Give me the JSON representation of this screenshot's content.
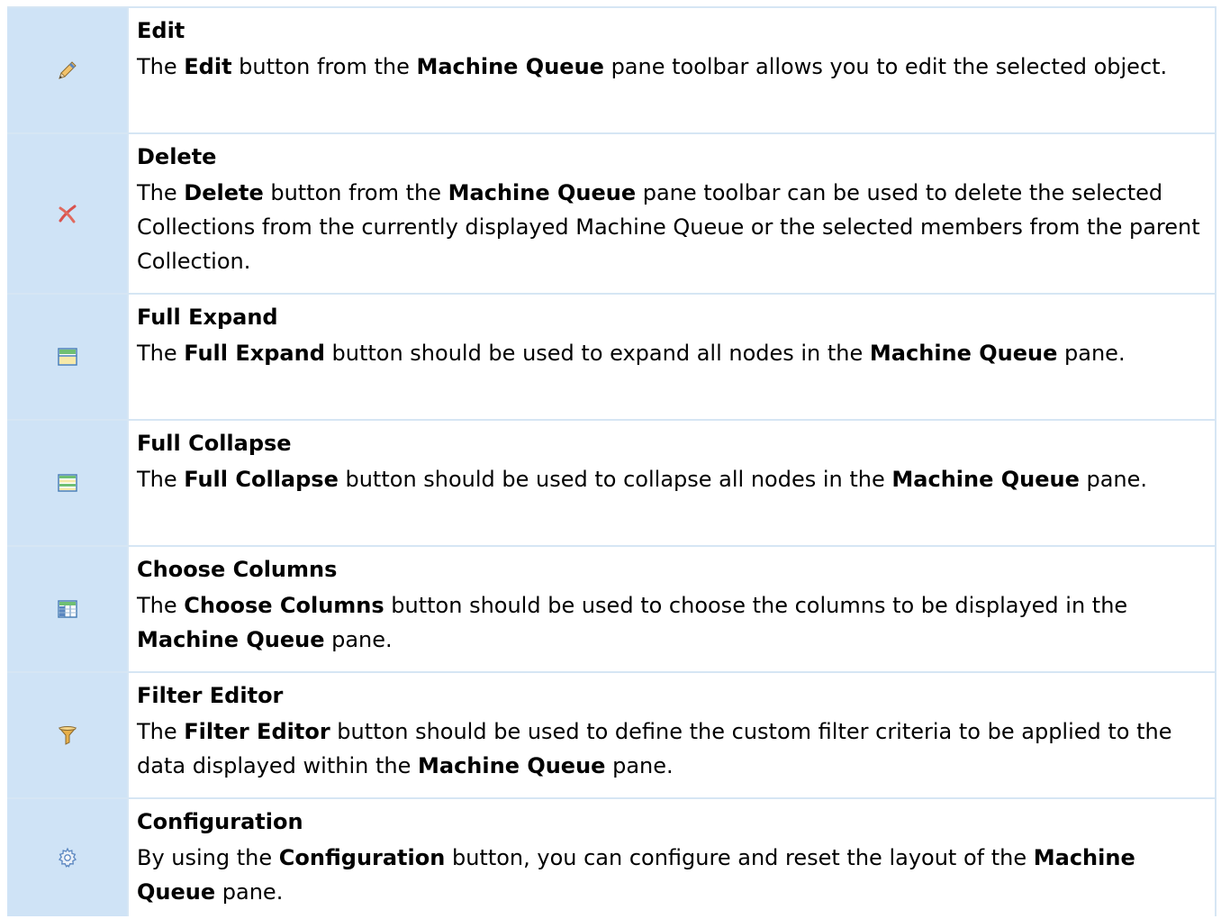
{
  "rows": [
    {
      "icon": "pencil-icon",
      "title": "Edit",
      "desc": [
        {
          "t": "The "
        },
        {
          "t": "Edit",
          "b": true
        },
        {
          "t": " button from the "
        },
        {
          "t": "Machine Queue",
          "b": true
        },
        {
          "t": " pane toolbar allows you to edit the selected object."
        }
      ]
    },
    {
      "icon": "delete-x-icon",
      "title": "Delete",
      "desc": [
        {
          "t": "The "
        },
        {
          "t": "Delete",
          "b": true
        },
        {
          "t": " button from the "
        },
        {
          "t": "Machine Queue",
          "b": true
        },
        {
          "t": " pane toolbar can be used to delete the selected Collections from the currently displayed Machine Queue or the selected members from the parent Collection."
        }
      ]
    },
    {
      "icon": "full-expand-icon",
      "title": "Full Expand",
      "desc": [
        {
          "t": "The "
        },
        {
          "t": "Full Expand",
          "b": true
        },
        {
          "t": " button should be used to expand all nodes in the "
        },
        {
          "t": "Machine Queue",
          "b": true
        },
        {
          "t": " pane."
        }
      ]
    },
    {
      "icon": "full-collapse-icon",
      "title": "Full Collapse",
      "desc": [
        {
          "t": "The "
        },
        {
          "t": "Full Collapse",
          "b": true
        },
        {
          "t": " button should be used to collapse all nodes in the "
        },
        {
          "t": "Machine Queue",
          "b": true
        },
        {
          "t": " pane."
        }
      ]
    },
    {
      "icon": "choose-columns-icon",
      "title": "Choose Columns",
      "desc": [
        {
          "t": "The "
        },
        {
          "t": "Choose Columns",
          "b": true
        },
        {
          "t": " button should be used to choose the columns to be displayed in the "
        },
        {
          "t": "Machine Queue",
          "b": true
        },
        {
          "t": " pane."
        }
      ]
    },
    {
      "icon": "filter-funnel-icon",
      "title": "Filter Editor",
      "desc": [
        {
          "t": "The "
        },
        {
          "t": "Filter Editor",
          "b": true
        },
        {
          "t": " button should be used to define the custom filter criteria to be applied to the data displayed within the "
        },
        {
          "t": "Machine Queue",
          "b": true
        },
        {
          "t": " pane."
        }
      ]
    },
    {
      "icon": "configuration-gear-icon",
      "title": "Configuration",
      "desc": [
        {
          "t": "By using the "
        },
        {
          "t": "Configuration",
          "b": true
        },
        {
          "t": " button, you can configure and reset the layout of the "
        },
        {
          "t": "Machine Queue",
          "b": true
        },
        {
          "t": " pane."
        }
      ]
    }
  ]
}
